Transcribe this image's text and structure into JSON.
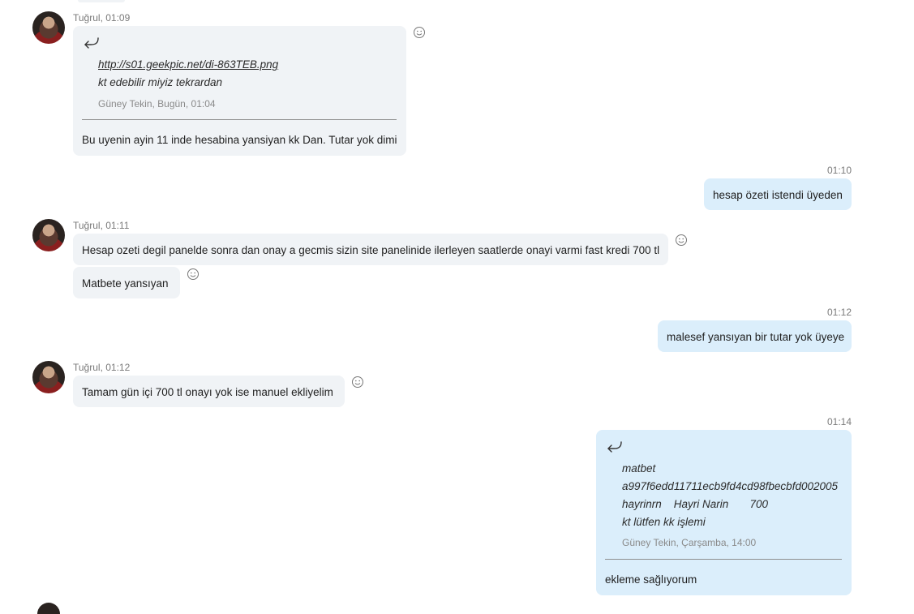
{
  "messages": [
    {
      "sender_time": "Tuğrul, 01:09",
      "quote": {
        "link": "http://s01.geekpic.net/di-863TEB.png",
        "line2": "kt edebilir miyiz tekrardan",
        "meta": "Güney Tekin, Bugün, 01:04"
      },
      "text": "Bu uyenin ayin 11 inde hesabina yansiyan kk Dan. Tutar yok dimi"
    },
    {
      "time": "01:10",
      "text": "hesap özeti istendi üyeden"
    },
    {
      "sender_time": "Tuğrul, 01:11",
      "text": "Hesap ozeti degil panelde sonra dan onay a gecmis sizin  site panelinide ilerleyen saatlerde onayi varmi fast kredi 700 tl",
      "text2": "Matbete yansıyan"
    },
    {
      "time": "01:12",
      "text": "malesef yansıyan bir tutar yok üyeye"
    },
    {
      "sender_time": "Tuğrul, 01:12",
      "text": "Tamam gün içi 700 tl onayı yok ise manuel ekliyelim"
    },
    {
      "time": "01:14",
      "quote": {
        "line1": "matbet",
        "line2": "a997f6edd11711ecb9fd4cd98fbecbfd002005",
        "line3": "hayrinrn    Hayri Narin       700",
        "line4": "kt lütfen kk işlemi",
        "meta": "Güney Tekin, Çarşamba, 14:00"
      },
      "text": "ekleme sağlıyorum"
    }
  ],
  "icons": {
    "reply": "reply-arrow-icon",
    "reaction": "smiley-icon"
  },
  "colors": {
    "incoming_bubble": "#f0f3f6",
    "outgoing_bubble": "#dbeefb",
    "meta_text": "#7a7a7a"
  }
}
